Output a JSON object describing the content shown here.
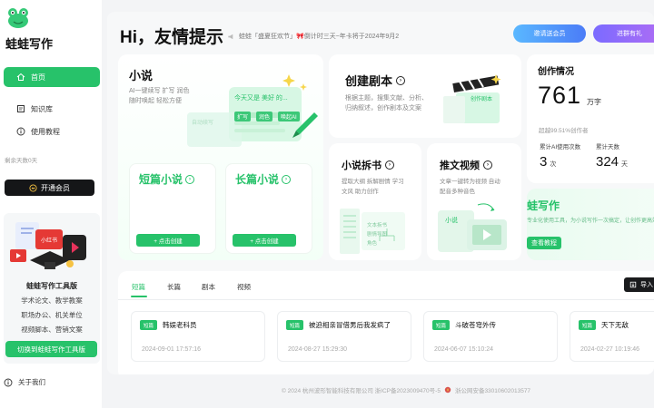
{
  "sidebar": {
    "brand": "蛙蛙写作",
    "nav": [
      {
        "label": "首页",
        "icon": "home-icon",
        "active": true
      },
      {
        "label": "知识库",
        "icon": "knowledge-base-icon",
        "active": false
      },
      {
        "label": "使用教程",
        "icon": "info-icon",
        "active": false
      }
    ],
    "remaining_days": "剩余天数0天",
    "open_member": "开通会员",
    "toolbox": {
      "title": "蛙蛙写作工具版",
      "lines": [
        "学术论文、教学教案",
        "职场办公、机关单位",
        "视频脚本、营销文案"
      ],
      "switch_label": "切换到蛙蛙写作工具版",
      "badge": "小红书"
    },
    "about": "关于我们"
  },
  "header": {
    "greeting": "Hi，友情提示",
    "marquee": "蛙蛙「盛夏狂欢节」🎀倒计时三天~年卡将于2024年9月2",
    "vip_button": "邀请送会员",
    "vip_button2": "进群有礼"
  },
  "novel": {
    "title": "小说",
    "desc": [
      "AI一键续写 扩写 润色",
      "随时唤起 轻松方便"
    ],
    "illustration": {
      "prompt_text": "今天又是 美好 的...",
      "chips": [
        "扩写",
        "润色",
        "唤起AI"
      ],
      "auto_label": "自动续写"
    },
    "short": {
      "title": "短篇小说",
      "button": "+ 点击创建"
    },
    "long": {
      "title": "长篇小说",
      "button": "+ 点击创建"
    }
  },
  "script": {
    "title": "创建剧本",
    "desc": [
      "根据主题，搜集文献、分析、",
      "归纳叙述，创作剧本及文案"
    ],
    "illustration_label": "创作剧本"
  },
  "split": {
    "title": "小说拆书",
    "desc": [
      "提取大纲 拆解剧情 学习",
      "文风 助力创作"
    ],
    "illustration_lines": [
      "文本拆书",
      "剧情导图",
      "角色"
    ]
  },
  "video": {
    "title": "推文视频",
    "desc": [
      "文章一键转为视频 自动",
      "配音多种音色"
    ],
    "illustration_label": "小说"
  },
  "stats": {
    "title": "创作情况",
    "total": "761",
    "total_unit": "万字",
    "beat_text": "超越99.51%创作者",
    "items": [
      {
        "label": "累计AI使用次数",
        "value": "3",
        "unit": "次"
      },
      {
        "label": "累计天数",
        "value": "324",
        "unit": "天"
      }
    ]
  },
  "promo": {
    "title": "蛙写作",
    "desc": "专业化使用工具，为小说写作一次搞定，让创作更高效",
    "button": "查看教程"
  },
  "tabs": {
    "items": [
      "短篇",
      "长篇",
      "剧本",
      "视频"
    ],
    "active": 0,
    "import": "导入"
  },
  "documents": [
    {
      "badge": "短篇",
      "title": "韩娱老科员",
      "time": "2024-09-01 17:57:16"
    },
    {
      "badge": "短篇",
      "title": "被迫相亲冒借男后我发疯了",
      "time": "2024-08-27 15:29:30"
    },
    {
      "badge": "短篇",
      "title": "斗破苍穹外传",
      "time": "2024-06-07 15:10:24"
    },
    {
      "badge": "短篇",
      "title": "天下无敌",
      "time": "2024-02-27 10:19:46"
    }
  ],
  "footer": {
    "left": "© 2024 杭州波形智能科技有限公司 浙ICP备2023009470号-5",
    "right": "浙公网安备33010602013577"
  },
  "colors": {
    "accent": "#27c26a",
    "dark": "#151618",
    "vip_blue": "#4b7cf7",
    "vip_purple": "#b06cf4"
  }
}
